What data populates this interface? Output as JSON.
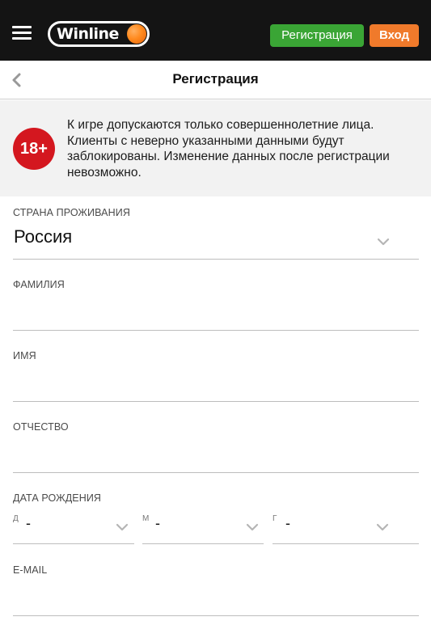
{
  "header": {
    "logo_text": "Winline",
    "register_label": "Регистрация",
    "login_label": "Вход"
  },
  "subheader": {
    "title": "Регистрация"
  },
  "notice": {
    "age_badge": "18+",
    "text": "К игре допускаются только совершеннолетние лица. Клиенты с неверно указанными данными будут заблокированы. Изменение данных после регистрации невозможно."
  },
  "form": {
    "country": {
      "label": "Страна проживания",
      "value": "Россия"
    },
    "last_name": {
      "label": "Фамилия",
      "value": ""
    },
    "first_name": {
      "label": "Имя",
      "value": ""
    },
    "patronymic": {
      "label": "Отчество",
      "value": ""
    },
    "birth_date": {
      "label": "Дата рождения",
      "day": {
        "sublabel": "Д",
        "value": "-"
      },
      "month": {
        "sublabel": "М",
        "value": "-"
      },
      "year": {
        "sublabel": "Г",
        "value": "-"
      }
    },
    "email": {
      "label": "E-mail",
      "value": ""
    }
  },
  "colors": {
    "topbar": "#141414",
    "register_button": "#3aa535",
    "login_button": "#f07a2b",
    "age_badge": "#d4171f",
    "notice_bg": "#f2f2f2"
  },
  "icons": [
    "menu-icon",
    "winline-ball-icon",
    "chevron-left-icon",
    "chevron-down-icon"
  ]
}
